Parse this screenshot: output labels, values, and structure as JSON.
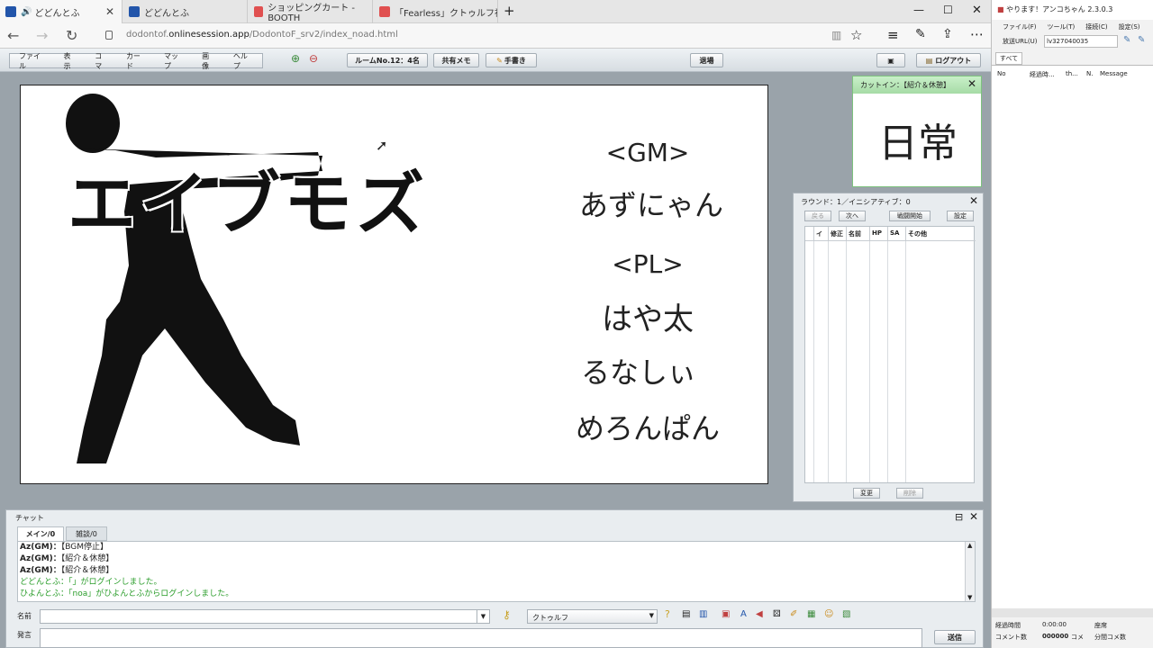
{
  "browser": {
    "tabs": [
      {
        "title": "どどんとふ",
        "icon_color": "#2255aa"
      },
      {
        "title": "どどんとふ",
        "icon_color": "#2255aa"
      },
      {
        "title": "ショッピングカート - BOOTH",
        "icon_color": "#e05050"
      },
      {
        "title": "「Fearless」クトゥルフ神話TRPG",
        "icon_color": "#e05050"
      }
    ],
    "new_tab": "+",
    "url_prefix": "dodontof.",
    "url_domain": "onlinesession.app",
    "url_path": "/DodontoF_srv2/index_noad.html"
  },
  "app": {
    "menus": [
      "ファイル",
      "表示",
      "コマ",
      "カード",
      "マップ",
      "画像",
      "ヘルプ"
    ],
    "room_button": "ルームNo.12：4名",
    "memo_button": "共有メモ",
    "handwrite_button": "手書き",
    "leave_button": "退場",
    "logout_button": "ログアウト"
  },
  "map": {
    "title": "エイブモズ",
    "gm_label": "<GM>",
    "gm_name": "あずにゃん",
    "pl_label": "<PL>",
    "players": [
      "はや太",
      "るなしぃ",
      "めろんぱん"
    ]
  },
  "cutin": {
    "title": "カットイン：【紹介＆休憩】",
    "text": "日常"
  },
  "initiative": {
    "title": "ラウンド：1／イニシアティブ：0",
    "back_label": "戻る",
    "next_label": "次へ",
    "start_label": "戦闘開始",
    "settings_label": "設定",
    "columns": [
      "イニ",
      "修正",
      "名前",
      "HP",
      "SA",
      "その他"
    ],
    "change_label": "変更",
    "delete_label": "削除"
  },
  "chat": {
    "title": "チャット",
    "tabs": [
      "メイン/0",
      "雑談/0"
    ],
    "messages": [
      {
        "name": "Az(GM)：",
        "text": "【BGM停止】",
        "color": "#222222"
      },
      {
        "name": "Az(GM)：",
        "text": "【紹介＆休憩】",
        "color": "#222222"
      },
      {
        "name": "Az(GM)：",
        "text": "【紹介＆休憩】",
        "color": "#222222"
      },
      {
        "name": "",
        "text": "どどんとふ：「」がログインしました。",
        "color": "#2a9d2a"
      },
      {
        "name": "",
        "text": "ひよんとふ：「noa」がひよんとふからログインしました。",
        "color": "#2a9d2a"
      }
    ],
    "name_label": "名前",
    "system_value": "クトゥルフ",
    "say_label": "発言",
    "send_label": "送信"
  },
  "side_panel": {
    "title": "やります！アンコちゃん 2.3.0.3",
    "menus": [
      "ファイル(F)",
      "ツール(T)",
      "接続(C)",
      "設定(S)"
    ],
    "url_label": "放送URL(U)",
    "url_value": "lv327040035",
    "tab_all": "すべて",
    "columns": [
      "No",
      "経過時...",
      "th...",
      "N.",
      "Message"
    ],
    "status_elapsed_label": "経過時間",
    "status_elapsed_value": "0:00:00",
    "status_seats_label": "座席",
    "status_comments_label": "コメント数",
    "status_comments_value": "000000",
    "status_comments_unit": "コメ",
    "status_rate_label": "分間コメ数"
  }
}
